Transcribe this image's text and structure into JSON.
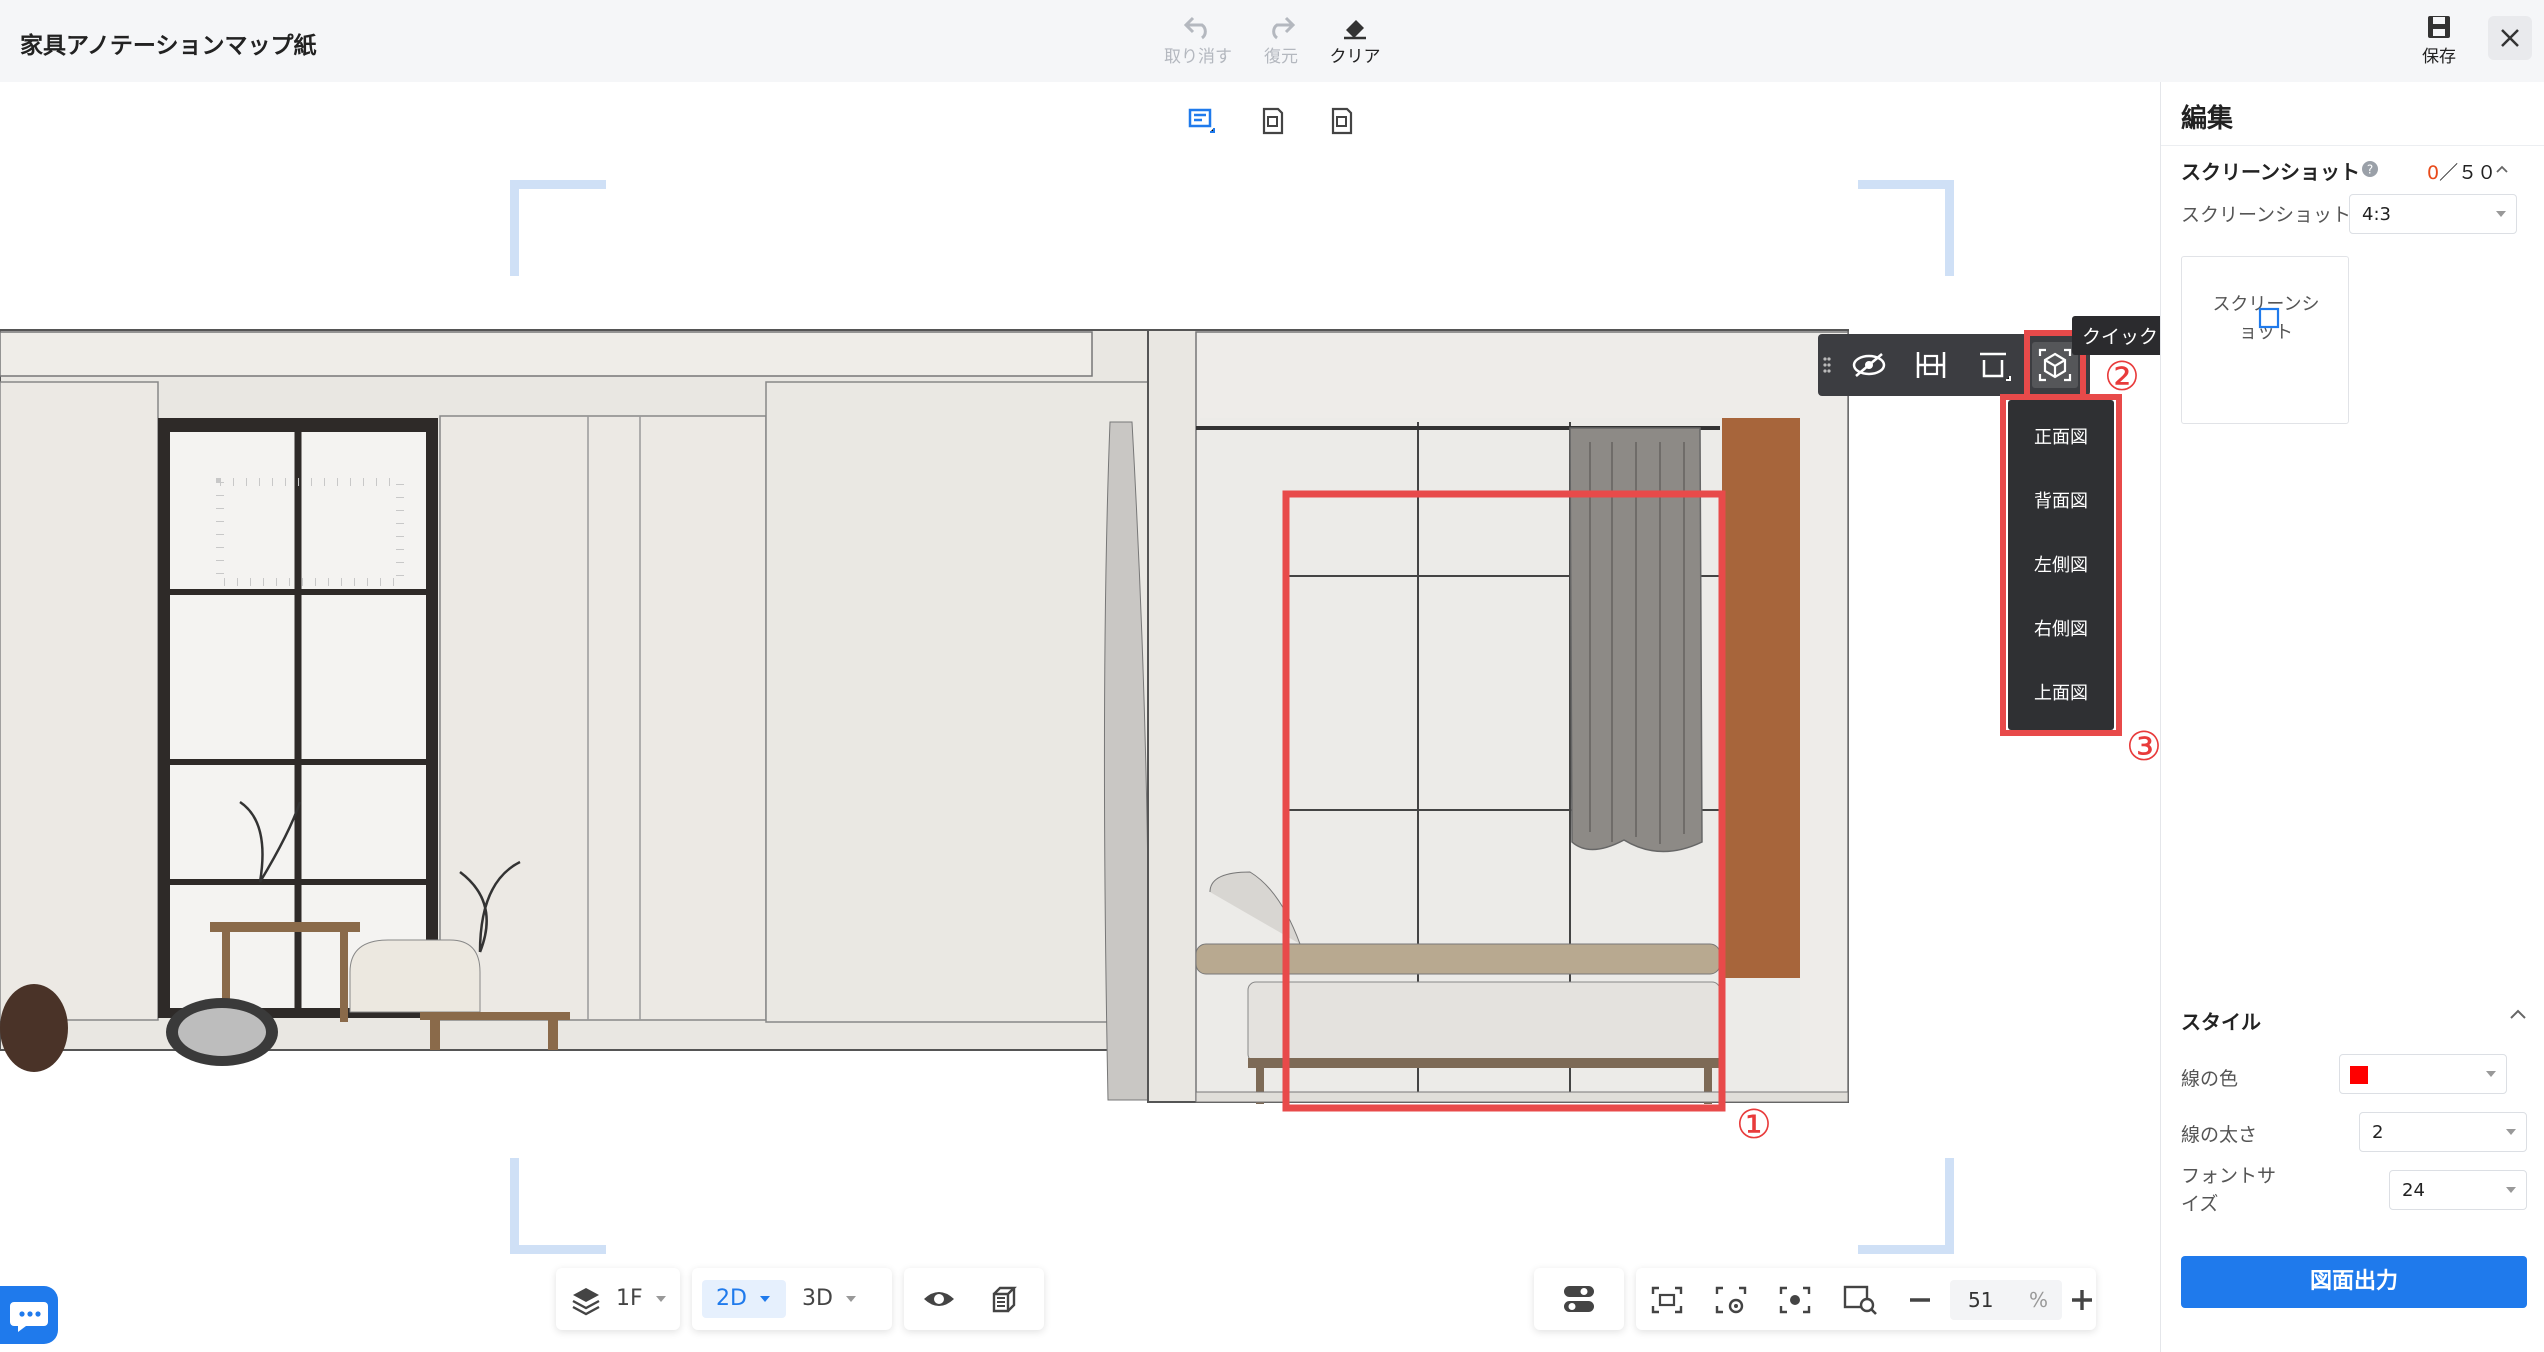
{
  "app": {
    "title": "家具アノテーションマップ紙"
  },
  "toolbar": {
    "undo": "取り消す",
    "redo": "復元",
    "clear": "クリア",
    "save": "保存"
  },
  "floating_toolbar": {
    "tooltip": "クイックビュー",
    "menu_items": [
      "正面図",
      "背面図",
      "左側図",
      "右側図",
      "上面図"
    ]
  },
  "annotations": {
    "one": "①",
    "two": "②",
    "three": "③"
  },
  "panel": {
    "title": "編集",
    "screenshot": {
      "label": "スクリーンショット",
      "count_current": "0",
      "count_max": "／５０",
      "ratio_label": "スクリーンショット比率",
      "ratio_value": "4:3",
      "thumb_text": "スクリーンショット"
    },
    "style": {
      "title": "スタイル",
      "line_color_label": "線の色",
      "line_color": "#ff0000",
      "line_width_label": "線の太さ",
      "line_width_value": "2",
      "font_size_label": "フォントサイズ",
      "font_size_value": "24"
    },
    "export_label": "図面出力"
  },
  "bottom": {
    "floor": "1F",
    "mode_2d": "2D",
    "mode_3d": "3D",
    "zoom_value": "51",
    "zoom_unit": "%"
  },
  "colors": {
    "accent": "#1f7aec",
    "highlight": "#e84a4a",
    "annotation_red": "#e83b3b"
  }
}
